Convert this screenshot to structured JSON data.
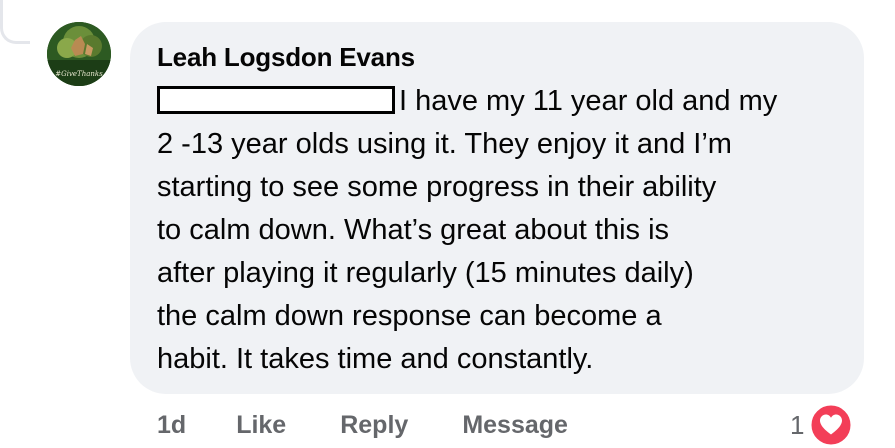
{
  "comment": {
    "author": "Leah Logsdon Evans",
    "text_lines": [
      "I have my 11 year old and my",
      "2 -13 year olds using it. They enjoy it and I’m",
      "starting to see some progress in their ability",
      "to calm down. What’s great about this is",
      "after playing it regularly (15 minutes daily)",
      "the calm down response can become a",
      "habit. It takes time and constantly."
    ],
    "avatar": {
      "label": "#GiveThanks",
      "icon": "profile-photo"
    }
  },
  "actions": {
    "time": "1d",
    "like": "Like",
    "reply": "Reply",
    "message": "Message"
  },
  "reactions": {
    "count": "1",
    "icon": "love-heart-icon",
    "color": "#f33e58"
  },
  "colors": {
    "bubble": "#f0f2f5",
    "text": "#050505",
    "secondary": "#65676b"
  }
}
